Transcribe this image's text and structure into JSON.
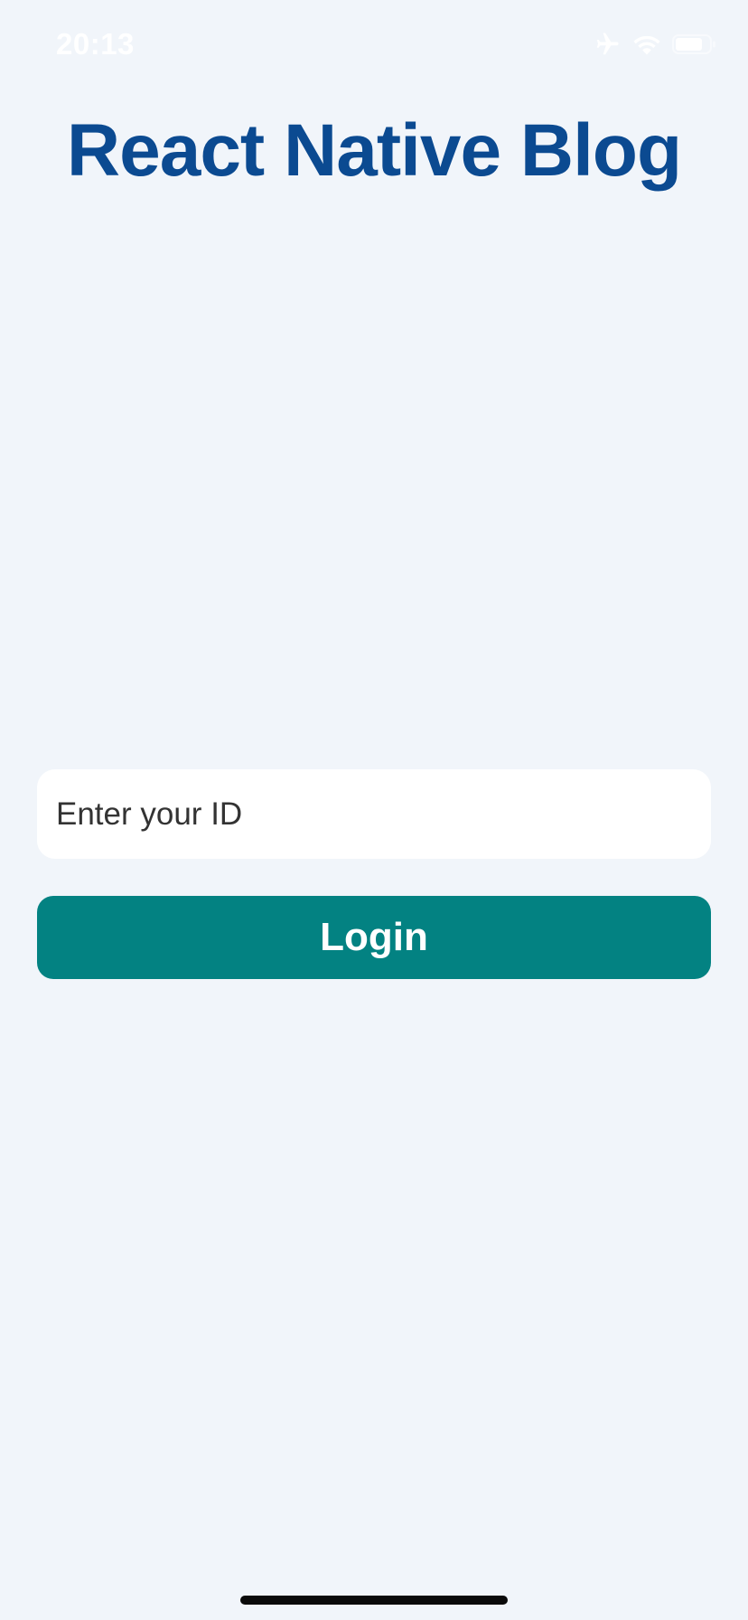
{
  "status_bar": {
    "time": "20:13",
    "icons": [
      "airplane-icon",
      "wifi-icon",
      "battery-icon"
    ]
  },
  "header": {
    "title": "React Native Blog"
  },
  "login_form": {
    "id_placeholder": "Enter your ID",
    "id_value": "",
    "login_label": "Login"
  },
  "colors": {
    "background": "#f1f5fa",
    "title": "#0b4a91",
    "button": "#038282",
    "button_text": "#ffffff",
    "input_background": "#ffffff"
  }
}
